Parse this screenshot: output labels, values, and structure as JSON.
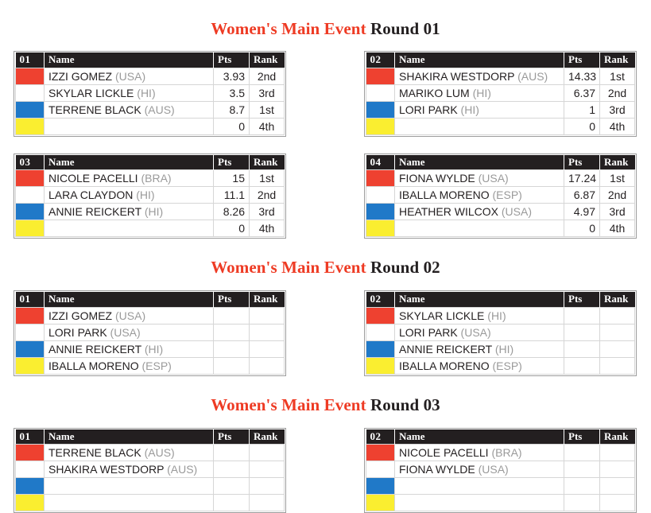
{
  "colors": {
    "event_red": "#ee3b24",
    "round_black": "#231f20",
    "header_bg": "#231f20",
    "lane_red": "#ee4130",
    "lane_white": "#ffffff",
    "lane_blue": "#2079c8",
    "lane_yellow": "#faee30",
    "country_gray": "#9a9a9a",
    "grid_line": "#d6d6d6",
    "table_border": "#9d9d9d"
  },
  "columns": {
    "name": "Name",
    "pts": "Pts",
    "rank": "Rank"
  },
  "rounds": [
    {
      "event_label": "Women's Main Event ",
      "round_label": "Round 01",
      "heats": [
        {
          "number": "01",
          "rows": [
            {
              "lane": "red",
              "athlete": "IZZI GOMEZ",
              "country": "(USA)",
              "pts": "3.93",
              "rank": "2nd"
            },
            {
              "lane": "white",
              "athlete": "SKYLAR LICKLE",
              "country": "(HI)",
              "pts": "3.5",
              "rank": "3rd"
            },
            {
              "lane": "blue",
              "athlete": "TERRENE BLACK",
              "country": "(AUS)",
              "pts": "8.7",
              "rank": "1st"
            },
            {
              "lane": "yellow",
              "athlete": "",
              "country": "",
              "pts": "0",
              "rank": "4th"
            }
          ]
        },
        {
          "number": "02",
          "rows": [
            {
              "lane": "red",
              "athlete": "SHAKIRA WESTDORP",
              "country": "(AUS)",
              "pts": "14.33",
              "rank": "1st"
            },
            {
              "lane": "white",
              "athlete": "MARIKO LUM",
              "country": "(HI)",
              "pts": "6.37",
              "rank": "2nd"
            },
            {
              "lane": "blue",
              "athlete": "LORI PARK",
              "country": "(HI)",
              "pts": "1",
              "rank": "3rd"
            },
            {
              "lane": "yellow",
              "athlete": "",
              "country": "",
              "pts": "0",
              "rank": "4th"
            }
          ]
        },
        {
          "number": "03",
          "rows": [
            {
              "lane": "red",
              "athlete": "NICOLE PACELLI",
              "country": "(BRA)",
              "pts": "15",
              "rank": "1st"
            },
            {
              "lane": "white",
              "athlete": "LARA CLAYDON",
              "country": "(HI)",
              "pts": "11.1",
              "rank": "2nd"
            },
            {
              "lane": "blue",
              "athlete": "ANNIE REICKERT",
              "country": "(HI)",
              "pts": "8.26",
              "rank": "3rd"
            },
            {
              "lane": "yellow",
              "athlete": "",
              "country": "",
              "pts": "0",
              "rank": "4th"
            }
          ]
        },
        {
          "number": "04",
          "rows": [
            {
              "lane": "red",
              "athlete": "FIONA WYLDE",
              "country": "(USA)",
              "pts": "17.24",
              "rank": "1st"
            },
            {
              "lane": "white",
              "athlete": "IBALLA MORENO",
              "country": "(ESP)",
              "pts": "6.87",
              "rank": "2nd"
            },
            {
              "lane": "blue",
              "athlete": "HEATHER WILCOX",
              "country": "(USA)",
              "pts": "4.97",
              "rank": "3rd"
            },
            {
              "lane": "yellow",
              "athlete": "",
              "country": "",
              "pts": "0",
              "rank": "4th"
            }
          ]
        }
      ]
    },
    {
      "event_label": "Women's Main Event ",
      "round_label": "Round 02",
      "heats": [
        {
          "number": "01",
          "rows": [
            {
              "lane": "red",
              "athlete": "IZZI GOMEZ",
              "country": "(USA)",
              "pts": "",
              "rank": ""
            },
            {
              "lane": "white",
              "athlete": "LORI PARK",
              "country": "(USA)",
              "pts": "",
              "rank": ""
            },
            {
              "lane": "blue",
              "athlete": "ANNIE REICKERT",
              "country": "(HI)",
              "pts": "",
              "rank": ""
            },
            {
              "lane": "yellow",
              "athlete": "IBALLA MORENO",
              "country": "(ESP)",
              "pts": "",
              "rank": ""
            }
          ]
        },
        {
          "number": "02",
          "rows": [
            {
              "lane": "red",
              "athlete": "SKYLAR LICKLE",
              "country": "(HI)",
              "pts": "",
              "rank": ""
            },
            {
              "lane": "white",
              "athlete": "LORI PARK",
              "country": "(USA)",
              "pts": "",
              "rank": ""
            },
            {
              "lane": "blue",
              "athlete": "ANNIE REICKERT",
              "country": "(HI)",
              "pts": "",
              "rank": ""
            },
            {
              "lane": "yellow",
              "athlete": "IBALLA MORENO",
              "country": "(ESP)",
              "pts": "",
              "rank": ""
            }
          ]
        }
      ]
    },
    {
      "event_label": "Women's Main Event ",
      "round_label": "Round 03",
      "heats": [
        {
          "number": "01",
          "rows": [
            {
              "lane": "red",
              "athlete": "TERRENE BLACK",
              "country": "(AUS)",
              "pts": "",
              "rank": ""
            },
            {
              "lane": "white",
              "athlete": "SHAKIRA WESTDORP",
              "country": "(AUS)",
              "pts": "",
              "rank": ""
            },
            {
              "lane": "blue",
              "athlete": "",
              "country": "",
              "pts": "",
              "rank": ""
            },
            {
              "lane": "yellow",
              "athlete": "",
              "country": "",
              "pts": "",
              "rank": ""
            }
          ]
        },
        {
          "number": "02",
          "rows": [
            {
              "lane": "red",
              "athlete": "NICOLE PACELLI",
              "country": "(BRA)",
              "pts": "",
              "rank": ""
            },
            {
              "lane": "white",
              "athlete": "FIONA WYLDE",
              "country": "(USA)",
              "pts": "",
              "rank": ""
            },
            {
              "lane": "blue",
              "athlete": "",
              "country": "",
              "pts": "",
              "rank": ""
            },
            {
              "lane": "yellow",
              "athlete": "",
              "country": "",
              "pts": "",
              "rank": ""
            }
          ]
        }
      ]
    }
  ]
}
